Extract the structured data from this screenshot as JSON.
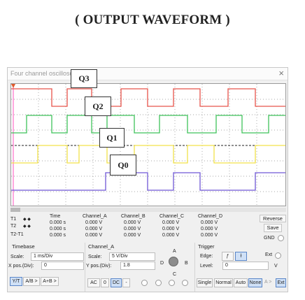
{
  "page": {
    "heading": "( OUTPUT WAVEFORM )"
  },
  "window": {
    "title": "Four channel oscillosco",
    "close_glyph": "×"
  },
  "waveform_labels": [
    "Q3",
    "Q2",
    "Q1",
    "Q0"
  ],
  "channel_colors": {
    "A": "#e8534a",
    "B": "#3fc25a",
    "C": "#f2e24a",
    "D": "#6f57d6"
  },
  "measure": {
    "headers": [
      "Time",
      "Channel_A",
      "Channel_B",
      "Channel_C",
      "Channel_D"
    ],
    "rows": [
      {
        "label": "T1",
        "values": [
          "0.000 s",
          "0.000 V",
          "0.000 V",
          "0.000 V",
          "0.000 V"
        ]
      },
      {
        "label": "T2",
        "values": [
          "0.000 s",
          "0.000 V",
          "0.000 V",
          "0.000 V",
          "0.000 V"
        ]
      },
      {
        "label": "T2-T1",
        "values": [
          "0.000 s",
          "0.000 V",
          "0.000 V",
          "0.000 V",
          "0.000 V"
        ]
      }
    ],
    "arrows": "◆ ◆"
  },
  "side": {
    "reverse": "Reverse",
    "save": "Save",
    "gnd": "GND"
  },
  "timebase": {
    "title": "Timebase",
    "scale_label": "Scale:",
    "scale_value": "1 ms/Div",
    "xpos_label": "X pos.(Div):",
    "xpos_value": "0",
    "modes": [
      "Y/T",
      "A/B >",
      "A+B >"
    ]
  },
  "channel": {
    "title": "Channel_A",
    "scale_label": "Scale:",
    "scale_value": "5  V/Div",
    "ypos_label": "Y pos.(Div):",
    "ypos_value": "1.8",
    "coupling": [
      "AC",
      "0",
      "DC",
      "-"
    ],
    "selector": {
      "A": "A",
      "B": "B",
      "C": "C",
      "D": "D"
    }
  },
  "trigger": {
    "title": "Trigger",
    "edge_label": "Edge:",
    "level_label": "Level:",
    "level_value": "0",
    "level_unit": "V",
    "ext_label": "Ext",
    "edge_rise": "ƒ",
    "edge_fall": "ł",
    "modes": [
      "Single",
      "Normal",
      "Auto",
      "None"
    ],
    "active_mode": "None",
    "a_arrow": "A >",
    "ext_btn": "Ext"
  }
}
